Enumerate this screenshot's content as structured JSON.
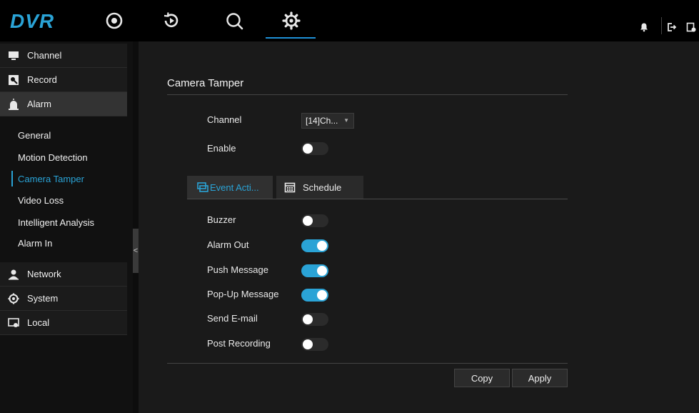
{
  "app": {
    "logo": "DVR"
  },
  "topnav": {
    "items": [
      {
        "name": "live-view",
        "icon": "target-icon"
      },
      {
        "name": "playback",
        "icon": "playback-icon"
      },
      {
        "name": "search",
        "icon": "search-icon"
      },
      {
        "name": "settings",
        "icon": "gear-icon",
        "active": true
      }
    ],
    "accent": "#1e90d6"
  },
  "sidebar": {
    "groups": [
      {
        "label": "Channel",
        "icon": "monitor-icon"
      },
      {
        "label": "Record",
        "icon": "record-icon"
      },
      {
        "label": "Alarm",
        "icon": "alarm-icon",
        "active": true
      },
      {
        "label": "Network",
        "icon": "user-network-icon"
      },
      {
        "label": "System",
        "icon": "gear-icon"
      },
      {
        "label": "Local",
        "icon": "local-icon"
      }
    ],
    "alarm_subitems": [
      {
        "label": "General"
      },
      {
        "label": "Motion Detection"
      },
      {
        "label": "Camera Tamper",
        "active": true
      },
      {
        "label": "Video Loss"
      },
      {
        "label": "Intelligent Analysis"
      },
      {
        "label": "Alarm In"
      }
    ],
    "collapse_glyph": "<"
  },
  "main": {
    "title": "Camera Tamper",
    "channel_label": "Channel",
    "channel_value": "[14]Ch...",
    "enable_label": "Enable",
    "enable_on": false,
    "tabs": [
      {
        "label": "Event Acti...",
        "active": true
      },
      {
        "label": "Schedule"
      }
    ],
    "actions": [
      {
        "label": "Buzzer",
        "on": false
      },
      {
        "label": "Alarm Out",
        "on": true
      },
      {
        "label": "Push Message",
        "on": true
      },
      {
        "label": "Pop-Up Message",
        "on": true
      },
      {
        "label": "Send E-mail",
        "on": false
      },
      {
        "label": "Post Recording",
        "on": false
      }
    ],
    "copy_label": "Copy",
    "apply_label": "Apply"
  },
  "colors": {
    "accent": "#2aa3d6",
    "panel": "#1a1a1a",
    "sidebar": "#111111"
  }
}
